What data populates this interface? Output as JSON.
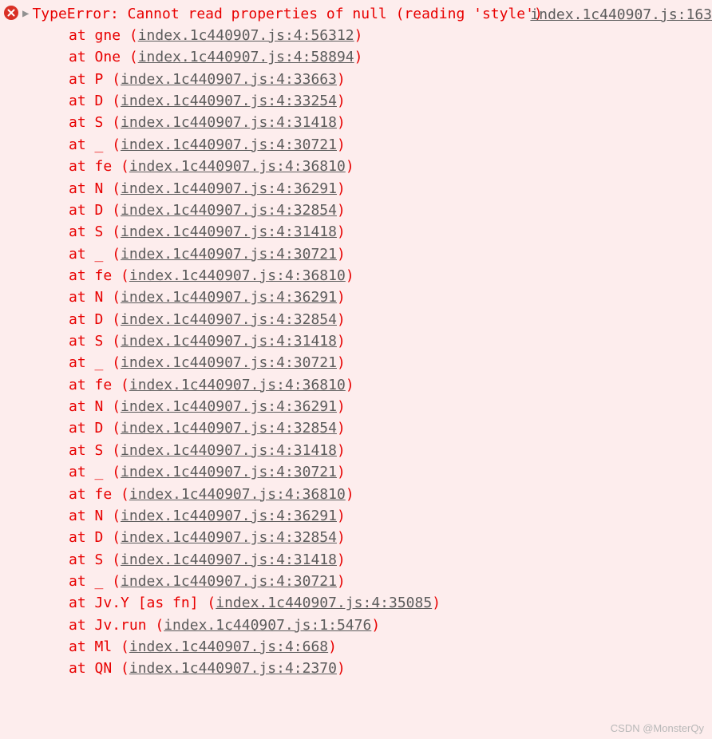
{
  "error": {
    "message": "TypeError: Cannot read properties of null (reading 'style')",
    "source_link": "index.1c440907.js:163",
    "at_label": "at ",
    "stack": [
      {
        "fn": "gne",
        "loc": "index.1c440907.js:4:56312"
      },
      {
        "fn": "One",
        "loc": "index.1c440907.js:4:58894"
      },
      {
        "fn": "P",
        "loc": "index.1c440907.js:4:33663"
      },
      {
        "fn": "D",
        "loc": "index.1c440907.js:4:33254"
      },
      {
        "fn": "S",
        "loc": "index.1c440907.js:4:31418"
      },
      {
        "fn": "_",
        "loc": "index.1c440907.js:4:30721"
      },
      {
        "fn": "fe",
        "loc": "index.1c440907.js:4:36810"
      },
      {
        "fn": "N",
        "loc": "index.1c440907.js:4:36291"
      },
      {
        "fn": "D",
        "loc": "index.1c440907.js:4:32854"
      },
      {
        "fn": "S",
        "loc": "index.1c440907.js:4:31418"
      },
      {
        "fn": "_",
        "loc": "index.1c440907.js:4:30721"
      },
      {
        "fn": "fe",
        "loc": "index.1c440907.js:4:36810"
      },
      {
        "fn": "N",
        "loc": "index.1c440907.js:4:36291"
      },
      {
        "fn": "D",
        "loc": "index.1c440907.js:4:32854"
      },
      {
        "fn": "S",
        "loc": "index.1c440907.js:4:31418"
      },
      {
        "fn": "_",
        "loc": "index.1c440907.js:4:30721"
      },
      {
        "fn": "fe",
        "loc": "index.1c440907.js:4:36810"
      },
      {
        "fn": "N",
        "loc": "index.1c440907.js:4:36291"
      },
      {
        "fn": "D",
        "loc": "index.1c440907.js:4:32854"
      },
      {
        "fn": "S",
        "loc": "index.1c440907.js:4:31418"
      },
      {
        "fn": "_",
        "loc": "index.1c440907.js:4:30721"
      },
      {
        "fn": "fe",
        "loc": "index.1c440907.js:4:36810"
      },
      {
        "fn": "N",
        "loc": "index.1c440907.js:4:36291"
      },
      {
        "fn": "D",
        "loc": "index.1c440907.js:4:32854"
      },
      {
        "fn": "S",
        "loc": "index.1c440907.js:4:31418"
      },
      {
        "fn": "_",
        "loc": "index.1c440907.js:4:30721"
      },
      {
        "fn": "Jv.Y [as fn]",
        "loc": "index.1c440907.js:4:35085"
      },
      {
        "fn": "Jv.run",
        "loc": "index.1c440907.js:1:5476"
      },
      {
        "fn": "Ml",
        "loc": "index.1c440907.js:4:668"
      },
      {
        "fn": "QN",
        "loc": "index.1c440907.js:4:2370"
      }
    ]
  },
  "watermark": "CSDN @MonsterQy"
}
